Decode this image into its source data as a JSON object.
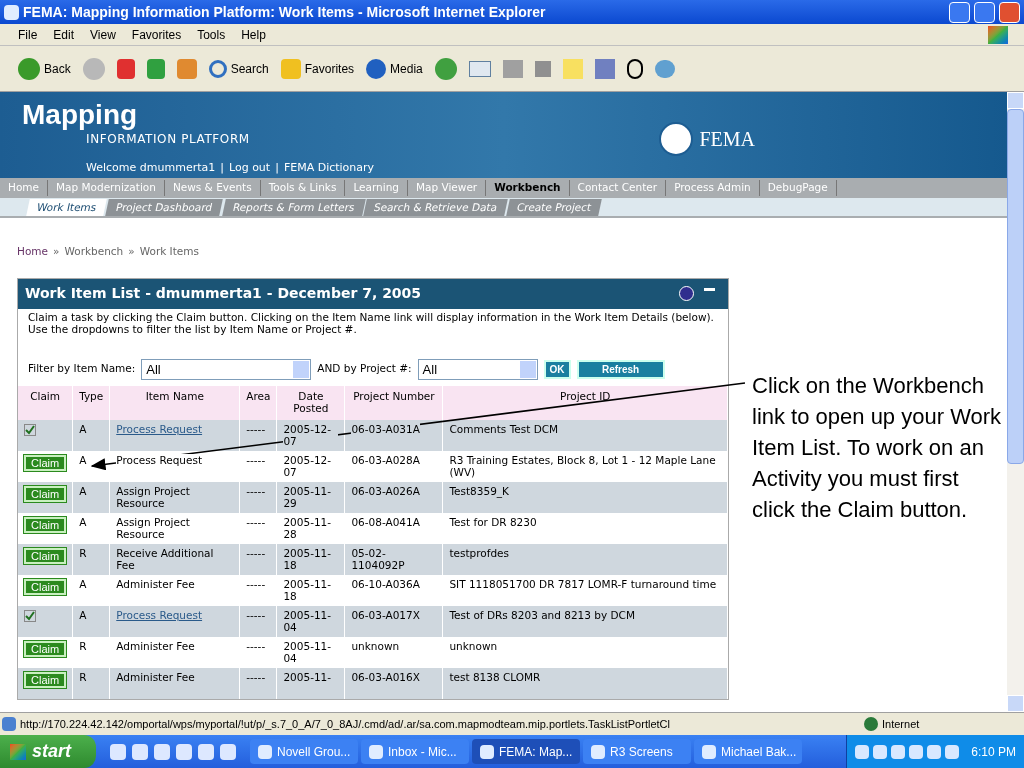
{
  "window": {
    "title": "FEMA: Mapping Information Platform: Work Items - Microsoft Internet Explorer"
  },
  "menu": [
    "File",
    "Edit",
    "View",
    "Favorites",
    "Tools",
    "Help"
  ],
  "toolbar": [
    {
      "kind": "back",
      "label": "Back"
    },
    {
      "kind": "forward"
    },
    {
      "kind": "stop"
    },
    {
      "kind": "refresh"
    },
    {
      "kind": "home"
    },
    {
      "kind": "search",
      "label": "Search"
    },
    {
      "kind": "favorites",
      "label": "Favorites"
    },
    {
      "kind": "media",
      "label": "Media"
    },
    {
      "kind": "history"
    },
    {
      "kind": "mail"
    },
    {
      "kind": "print"
    },
    {
      "kind": "edit"
    },
    {
      "kind": "note"
    },
    {
      "kind": "research"
    },
    {
      "kind": "messenger"
    },
    {
      "kind": "contacts"
    }
  ],
  "header": {
    "logo_title": "Mapping",
    "logo_subtitle": "INFORMATION PLATFORM",
    "user_links": [
      "Welcome dmummerta1",
      "Log out",
      "FEMA Dictionary"
    ],
    "separator": "|",
    "agency": "FEMA"
  },
  "nav": [
    {
      "label": "Home",
      "selected": false
    },
    {
      "label": "Map Modernization",
      "selected": false
    },
    {
      "label": "News & Events",
      "selected": false
    },
    {
      "label": "Tools & Links",
      "selected": false
    },
    {
      "label": "Learning",
      "selected": false
    },
    {
      "label": "Map Viewer",
      "selected": false
    },
    {
      "label": "Workbench",
      "selected": true
    },
    {
      "label": "Contact Center",
      "selected": false
    },
    {
      "label": "Process Admin",
      "selected": false
    },
    {
      "label": "DebugPage",
      "selected": false
    }
  ],
  "subnav": [
    {
      "label": "Work Items",
      "selected": true
    },
    {
      "label": "Project Dashboard",
      "selected": false
    },
    {
      "label": "Reports & Form Letters",
      "selected": false
    },
    {
      "label": "Search & Retrieve Data",
      "selected": false
    },
    {
      "label": "Create Project",
      "selected": false
    }
  ],
  "breadcrumb": [
    "Home",
    "Workbench",
    "Work Items"
  ],
  "breadcrumb_separator": "»",
  "panel": {
    "title": "Work Item List - dmummerta1 - December 7, 2005",
    "description": "Claim a task by clicking the Claim button. Clicking on the Item Name link will display information in the Work Item Details (below). Use the dropdowns to filter the list by Item Name or Project #.",
    "filters": {
      "item_label": "Filter by Item Name:",
      "item_value": "All",
      "project_label": "AND by Project #:",
      "project_value": "All",
      "ok": "OK",
      "refresh": "Refresh"
    },
    "columns": [
      "Claim",
      "Type",
      "Item Name",
      "Area",
      "Date Posted",
      "Project Number",
      "Project ID"
    ],
    "rows": [
      {
        "claim": {
          "kind": "checkbox",
          "checked": true
        },
        "type": "A",
        "item": "Process Request",
        "link": true,
        "area": "-----",
        "date": "2005-12-07",
        "number": "06-03-A031A",
        "id": "Comments Test DCM"
      },
      {
        "claim": {
          "kind": "button",
          "label": "Claim"
        },
        "type": "A",
        "item": "Process Request",
        "link": false,
        "area": "-----",
        "date": "2005-12-07",
        "number": "06-03-A028A",
        "id": "R3 Training Estates, Block 8, Lot 1 - 12 Maple Lane (WV)"
      },
      {
        "claim": {
          "kind": "button",
          "label": "Claim"
        },
        "type": "A",
        "item": "Assign Project Resource",
        "link": false,
        "area": "-----",
        "date": "2005-11-29",
        "number": "06-03-A026A",
        "id": "Test8359_K"
      },
      {
        "claim": {
          "kind": "button",
          "label": "Claim"
        },
        "type": "A",
        "item": "Assign Project Resource",
        "link": false,
        "area": "-----",
        "date": "2005-11-28",
        "number": "06-08-A041A",
        "id": "Test for DR 8230"
      },
      {
        "claim": {
          "kind": "button",
          "label": "Claim"
        },
        "type": "R",
        "item": "Receive Additional Fee",
        "link": false,
        "area": "-----",
        "date": "2005-11-18",
        "number": "05-02-1104092P",
        "id": "testprofdes"
      },
      {
        "claim": {
          "kind": "button",
          "label": "Claim"
        },
        "type": "A",
        "item": "Administer Fee",
        "link": false,
        "area": "-----",
        "date": "2005-11-18",
        "number": "06-10-A036A",
        "id": "SIT 1118051700 DR 7817 LOMR-F turnaround time"
      },
      {
        "claim": {
          "kind": "checkbox",
          "checked": true
        },
        "type": "A",
        "item": "Process Request",
        "link": true,
        "area": "-----",
        "date": "2005-11-04",
        "number": "06-03-A017X",
        "id": "Test of DRs 8203 and 8213 by DCM"
      },
      {
        "claim": {
          "kind": "button",
          "label": "Claim"
        },
        "type": "R",
        "item": "Administer Fee",
        "link": false,
        "area": "-----",
        "date": "2005-11-04",
        "number": "unknown",
        "id": "unknown"
      },
      {
        "claim": {
          "kind": "button",
          "label": "Claim"
        },
        "type": "R",
        "item": "Administer Fee",
        "link": false,
        "area": "-----",
        "date": "2005-11-",
        "number": "06-03-A016X",
        "id": "test 8138 CLOMR"
      }
    ]
  },
  "annotation": "Click on the Workbench link to open up your Work Item List. To work on an Activity you must first click the Claim button.",
  "status_bar": {
    "url": "http://170.224.42.142/omportal/wps/myportal/!ut/p/_s.7_0_A/7_0_8AJ/.cmd/ad/.ar/sa.com.mapmodteam.mip.portlets.TaskListPortletCl",
    "zone": "Internet"
  },
  "taskbar": {
    "start": "start",
    "tasks": [
      {
        "label": "Novell Grou...",
        "selected": false
      },
      {
        "label": "Inbox - Mic...",
        "selected": false
      },
      {
        "label": "FEMA: Map...",
        "selected": true
      },
      {
        "label": "R3 Screens",
        "selected": false
      },
      {
        "label": "Michael Bak...",
        "selected": false
      }
    ],
    "time": "6:10 PM"
  }
}
